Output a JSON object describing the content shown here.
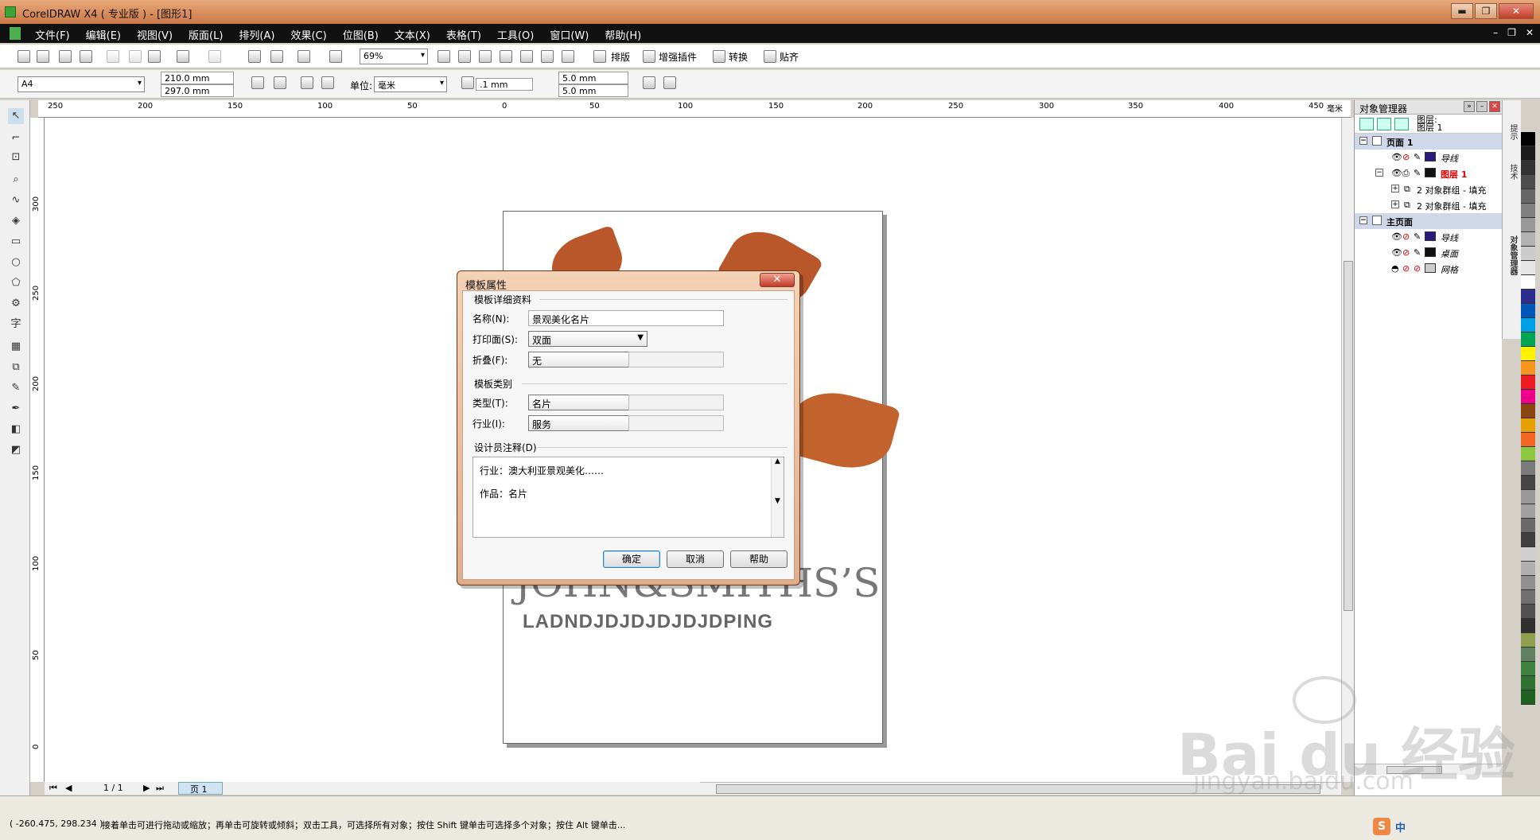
{
  "window": {
    "title": "CorelDRAW X4 ( 专业版 ) - [图形1]"
  },
  "menu": [
    "文件(F)",
    "编辑(E)",
    "视图(V)",
    "版面(L)",
    "排列(A)",
    "效果(C)",
    "位图(B)",
    "文本(X)",
    "表格(T)",
    "工具(O)",
    "窗口(W)",
    "帮助(H)"
  ],
  "toolbar1": {
    "zoom": "69%",
    "layout_label": "排版",
    "plugins_label": "增强插件",
    "convert_label": "转换",
    "snap_label": "贴齐"
  },
  "toolbar2": {
    "paper_size": "A4",
    "width": "210.0 mm",
    "height": "297.0 mm",
    "unit_label": "单位:",
    "unit": "毫米",
    "nudge": ".1 mm",
    "dup_x": "5.0 mm",
    "dup_y": "5.0 mm"
  },
  "ruler_top": [
    "250",
    "200",
    "150",
    "100",
    "50",
    "0",
    "50",
    "100",
    "150",
    "200",
    "250",
    "300",
    "350",
    "400",
    "450"
  ],
  "ruler_unit": "毫米",
  "ruler_left": [
    "300",
    "250",
    "200",
    "150",
    "100",
    "50",
    "0"
  ],
  "page_design": {
    "brand_name": "JOHN&SMITHS’S",
    "brand_sub": "LADNDJDJDJDJDJDPING"
  },
  "page_nav": {
    "counter": "1 / 1",
    "tab": "页 1"
  },
  "status": {
    "coords": "( -260.475, 298.234 )",
    "hint": "接着单击可进行拖动或缩放；再单击可旋转或倾斜；双击工具，可选择所有对象；按住 Shift 键单击可选择多个对象；按住 Alt 键单击..."
  },
  "object_manager": {
    "title": "对象管理器",
    "layer_header_line1": "图层:",
    "layer_header_line2": "图层 1",
    "tree": [
      {
        "label": "页面 1",
        "section": true
      },
      {
        "label": "导线",
        "color": "#2a1a7a"
      },
      {
        "label": "图层 1",
        "color": "#111111",
        "active": true
      },
      {
        "label": "2 对象群组 - 填充"
      },
      {
        "label": "2 对象群组 - 填充"
      },
      {
        "label": "主页面",
        "section": true
      },
      {
        "label": "导线",
        "color": "#2a1a7a"
      },
      {
        "label": "桌面",
        "color": "#111111"
      },
      {
        "label": "网格",
        "color": "#cccccc"
      }
    ]
  },
  "side_tabs": [
    "提示",
    "技术",
    "对象管理器"
  ],
  "palette_colors": [
    "#000000",
    "#1a1a1a",
    "#333333",
    "#4d4d4d",
    "#666666",
    "#808080",
    "#999999",
    "#b3b3b3",
    "#cccccc",
    "#e6e6e6",
    "#ffffff",
    "#2c2c8c",
    "#0057b8",
    "#00a0e9",
    "#00a651",
    "#fff200",
    "#f7941d",
    "#ed1c24",
    "#ec008c",
    "#8b4513",
    "#e8a000",
    "#f26522",
    "#8dc63f",
    "#7a7a7a",
    "#444444",
    "#999999",
    "#a0a0a0",
    "#6a6a6a",
    "#3f3f3f",
    "#cfcfcf",
    "#b0b0b0",
    "#909090",
    "#707070",
    "#505050",
    "#303030",
    "#8fa050",
    "#608060",
    "#408040",
    "#307030",
    "#206020"
  ],
  "dialog": {
    "title": "模板属性",
    "close": "✕",
    "group1_title": "模板详细资料",
    "name_label": "名称(N):",
    "name_value": "景观美化名片",
    "print_label": "打印面(S):",
    "print_value": "双面",
    "fold_label": "折叠(F):",
    "fold_value": "无",
    "group2_title": "模板类别",
    "type_label": "类型(T):",
    "type_value": "名片",
    "industry_label": "行业(I):",
    "industry_value": "服务",
    "notes_title": "设计员注释(D)",
    "notes_line1": "行业：澳大利亚景观美化……",
    "notes_line2": "作品：名片",
    "ok": "确定",
    "cancel": "取消",
    "help": "帮助"
  },
  "watermark": {
    "text": "Bai du 经验",
    "url": "jingyan.baidu.com"
  },
  "tray": {
    "ime": "中"
  }
}
